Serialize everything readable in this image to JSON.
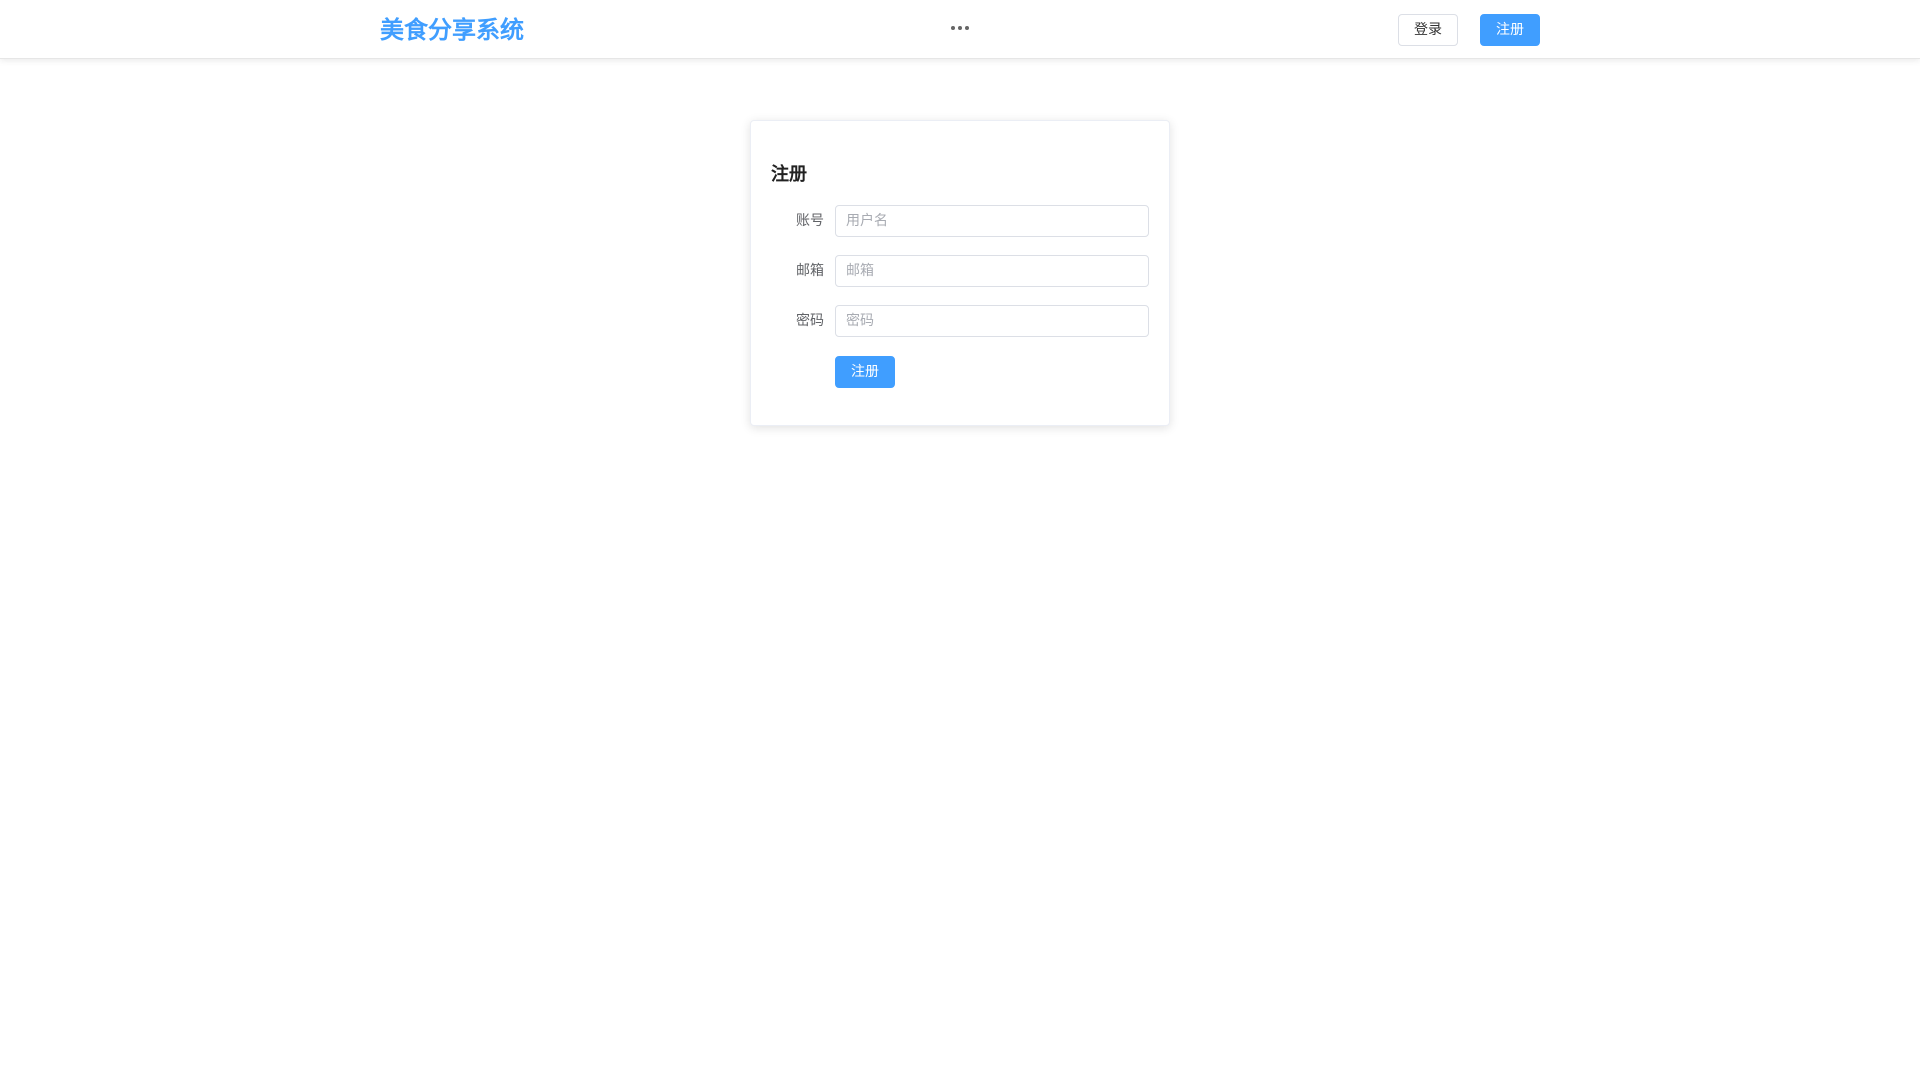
{
  "header": {
    "brand": "美食分享系统",
    "more_icon": "ellipsis-icon",
    "login_label": "登录",
    "register_label": "注册"
  },
  "register_form": {
    "title": "注册",
    "fields": [
      {
        "label": "账号",
        "placeholder": "用户名",
        "value": ""
      },
      {
        "label": "邮箱",
        "placeholder": "邮箱",
        "value": ""
      },
      {
        "label": "密码",
        "placeholder": "密码",
        "value": ""
      }
    ],
    "submit_label": "注册"
  },
  "colors": {
    "accent": "#409eff",
    "border": "#dcdfe6",
    "label_text": "#606266"
  }
}
